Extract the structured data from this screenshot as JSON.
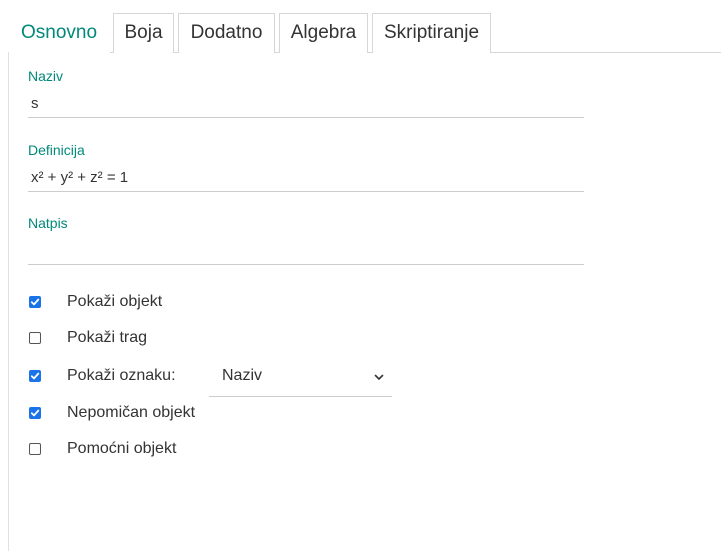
{
  "tabs": [
    {
      "label": "Osnovno",
      "active": true
    },
    {
      "label": "Boja",
      "active": false
    },
    {
      "label": "Dodatno",
      "active": false
    },
    {
      "label": "Algebra",
      "active": false
    },
    {
      "label": "Skriptiranje",
      "active": false
    }
  ],
  "fields": {
    "naziv": {
      "label": "Naziv",
      "value": "s"
    },
    "definicija": {
      "label": "Definicija",
      "value": "x² + y² + z² = 1"
    },
    "natpis": {
      "label": "Natpis",
      "value": ""
    }
  },
  "checkboxes": [
    {
      "label": "Pokaži objekt",
      "checked": true
    },
    {
      "label": "Pokaži trag",
      "checked": false
    },
    {
      "label": "Pokaži oznaku:",
      "checked": true
    },
    {
      "label": "Nepomičan objekt",
      "checked": true
    },
    {
      "label": "Pomoćni objekt",
      "checked": false
    }
  ],
  "label_dropdown": {
    "selected": "Naziv"
  },
  "colors": {
    "accent": "#00897b",
    "checkbox": "#1a73e8",
    "text": "#333333",
    "divider": "#cccccc"
  },
  "icons": {
    "check": "check-icon",
    "dropdown": "chevron-down-icon"
  }
}
